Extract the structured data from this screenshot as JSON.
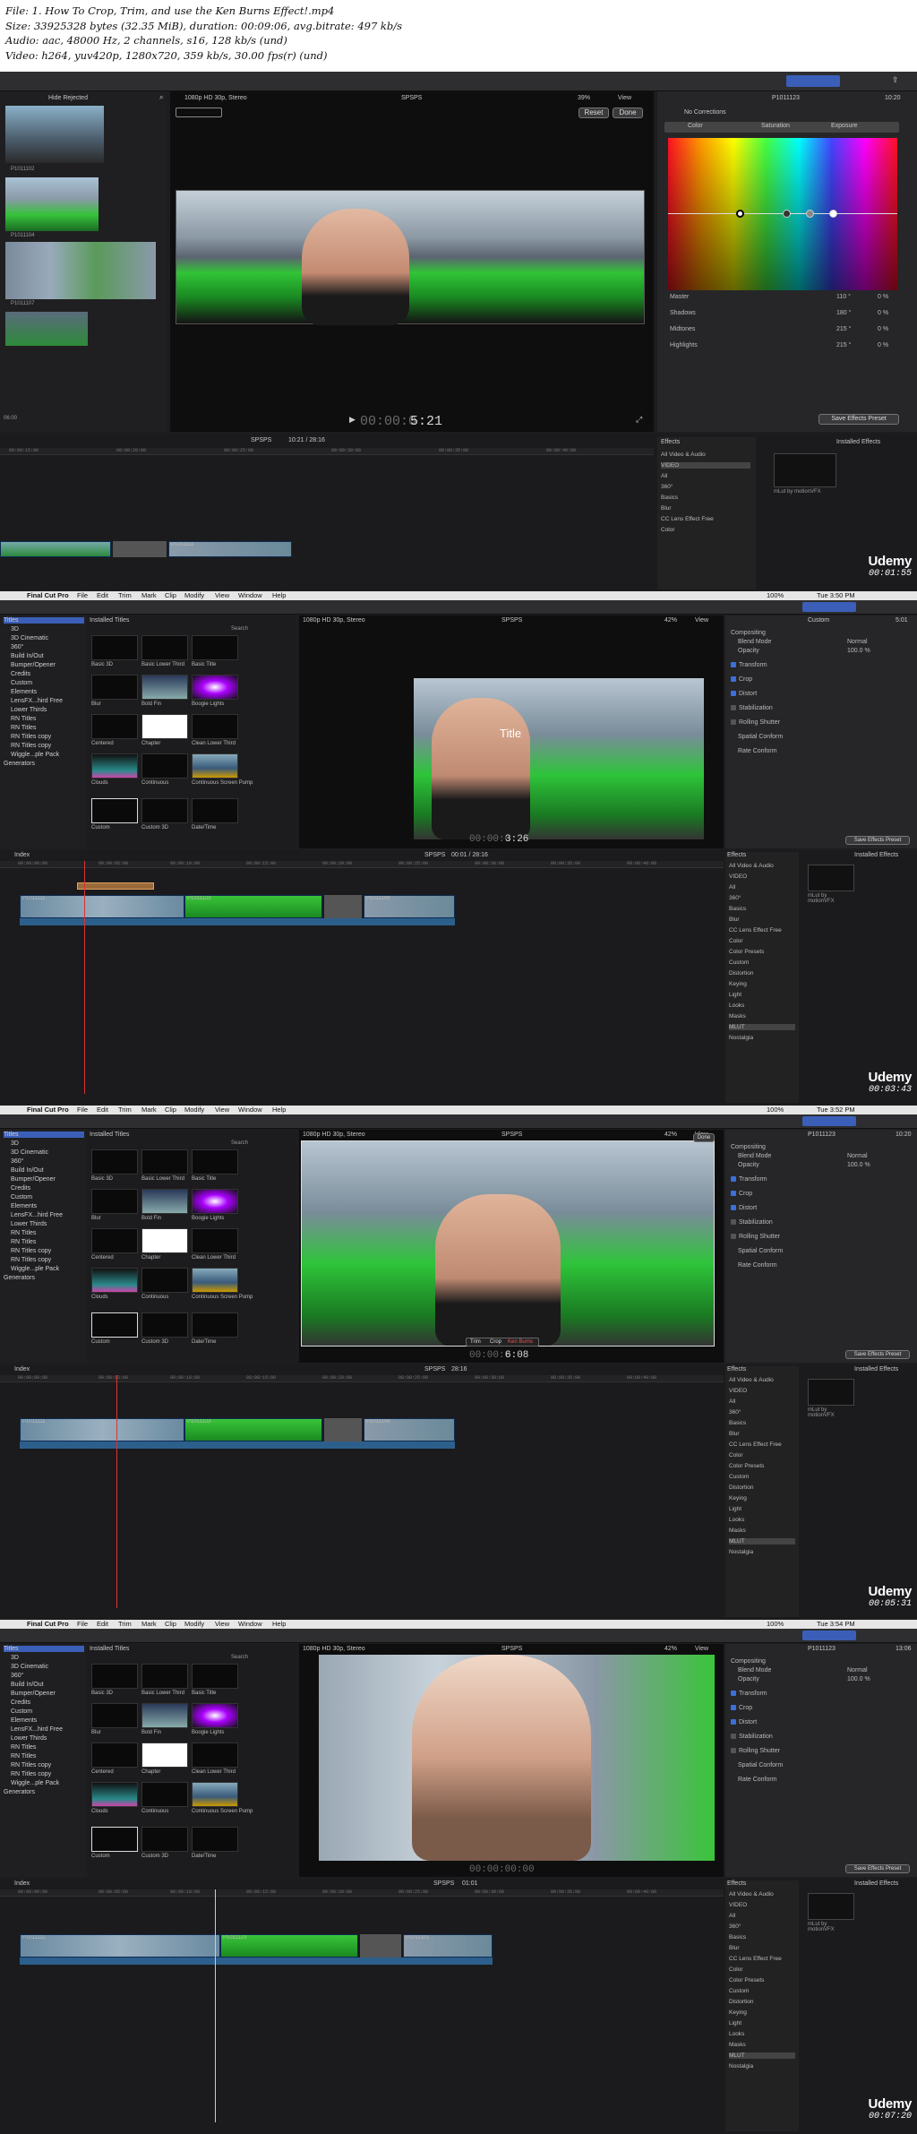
{
  "header": {
    "line1": "File: 1. How To Crop, Trim, and use the Ken Burns Effect!.mp4",
    "line2": "Size: 33925328 bytes (32.35 MiB), duration: 00:09:06, avg.bitrate: 497 kb/s",
    "line3": "Audio: aac, 48000 Hz, 2 channels, s16, 128 kb/s (und)",
    "line4": "Video: h264, yuv420p, 1280x720, 359 kb/s, 30.00 fps(r) (und)"
  },
  "watermark": {
    "brand": "Udemy"
  },
  "frame1": {
    "browser_filter": "Hide Rejected",
    "clip_names": [
      "P1011102",
      "P1011104",
      "P1011107"
    ],
    "browser_time": "06:00",
    "viewer_format": "1080p HD 30p, Stereo",
    "project": "SPSPS",
    "zoom": "39%",
    "view": "View",
    "reset": "Reset",
    "done": "Done",
    "timecode_dim": "00:00:0",
    "timecode": "5:21",
    "inspector_clip": "P1011123",
    "inspector_time": "10:20",
    "corrections": "No Corrections",
    "tabs": [
      "Color",
      "Saturation",
      "Exposure"
    ],
    "color_rows": [
      {
        "label": "Master",
        "value": "110 °",
        "pct": "0 %"
      },
      {
        "label": "Shadows",
        "value": "180 °",
        "pct": "0 %"
      },
      {
        "label": "Midtones",
        "value": "215 °",
        "pct": "0 %"
      },
      {
        "label": "Highlights",
        "value": "215 °",
        "pct": "0 %"
      }
    ],
    "save_preset": "Save Effects Preset",
    "timeline_project": "SPSPS",
    "timeline_time": "10:21 / 28:16",
    "ruler": [
      "00:00:15:00",
      "00:00:20:00",
      "00:00:25:00",
      "00:00:30:00",
      "00:00:35:00",
      "00:00:40:00",
      "00:00:45:00"
    ],
    "effects_title": "Effects",
    "installed": "Installed Effects",
    "effects_list": [
      "All Video & Audio",
      "VIDEO",
      "All",
      "360°",
      "Basics",
      "Blur",
      "CC Lens Effect Free",
      "Color"
    ],
    "plugin_name": "mLut by motionVFX",
    "clip_label": "P1011111",
    "udemy_time": "00:01:55"
  },
  "common": {
    "menus": [
      "Final Cut Pro",
      "File",
      "Edit",
      "Trim",
      "Mark",
      "Clip",
      "Modify",
      "View",
      "Window",
      "Help"
    ],
    "battery": "100%",
    "installed_titles": "Installed Titles",
    "search": "Search",
    "categories": [
      "Titles",
      "3D",
      "3D Cinematic",
      "360°",
      "Build In/Out",
      "Bumper/Opener",
      "Credits",
      "Custom",
      "Elements",
      "LensFX...hird Free",
      "Lower Thirds",
      "RN Titles",
      "RN Titles",
      "RN Titles  copy",
      "RN Titles copy",
      "Wiggle...ple Pack",
      "Generators"
    ],
    "title_thumbs": [
      "Basic 3D",
      "Basic Lower Third",
      "Basic Title",
      "Blur",
      "Bold Fin",
      "Boogie Lights",
      "Centered",
      "Chapter",
      "Clean Lower Third",
      "Clouds",
      "Continuous",
      "Continuous Screen Pump",
      "Custom",
      "Custom 3D",
      "Date/Time"
    ],
    "viewer_format": "1080p HD 30p, Stereo",
    "project": "SPSPS",
    "zoom": "42%",
    "view": "View",
    "compositing": "Compositing",
    "blend_mode": "Blend Mode",
    "blend_value": "Normal",
    "opacity": "Opacity",
    "opacity_value": "100.0 %",
    "inspector_items": [
      "Transform",
      "Crop",
      "Distort",
      "Stabilization",
      "Rolling Shutter",
      "Spatial Conform",
      "Rate Conform"
    ],
    "save_preset": "Save Effects Preset",
    "index": "Index",
    "effects_title": "Effects",
    "installed": "Installed Effects",
    "effects_list": [
      "All Video & Audio",
      "VIDEO",
      "All",
      "360°",
      "Basics",
      "Blur",
      "CC Lens Effect Free",
      "Color",
      "Color Presets",
      "Custom",
      "Distortion",
      "Keying",
      "Light",
      "Looks",
      "Masks",
      "MLUT",
      "Nostalgia"
    ],
    "plugin_name": "mLut by motionVFX",
    "ruler": [
      "00:00:00:00",
      "00:00:05:00",
      "00:00:10:00",
      "00:00:15:00",
      "00:00:20:00",
      "00:00:25:00",
      "00:00:30:00",
      "00:00:35:00",
      "00:00:40:00",
      "00:00:45:00"
    ],
    "clip_labels": [
      "P1011111",
      "P1011123",
      "P1011108",
      "P1011101"
    ]
  },
  "frame2": {
    "clock": "Tue 3:50 PM",
    "inspector_clip": "Custom",
    "inspector_time": "5:01",
    "timecode_dim": "00:00:0",
    "timecode": "3:26",
    "title_overlay": "Title",
    "timeline_time": "00:01 / 28:16",
    "udemy_time": "00:03:43"
  },
  "frame3": {
    "clock": "Tue 3:52 PM",
    "inspector_clip": "P1011123",
    "inspector_time": "10:20",
    "timecode_dim": "00:00:0",
    "timecode": "6:08",
    "crop_modes": [
      "Trim",
      "Crop",
      "Ken Burns"
    ],
    "done": "Done",
    "timeline_time": "28:16",
    "udemy_time": "00:05:31"
  },
  "frame4": {
    "clock": "Tue 3:54 PM",
    "inspector_clip": "P1011123",
    "inspector_time": "13:06",
    "timecode": "00:00:00:00",
    "timeline_time": "01:01",
    "udemy_time": "00:07:20"
  }
}
